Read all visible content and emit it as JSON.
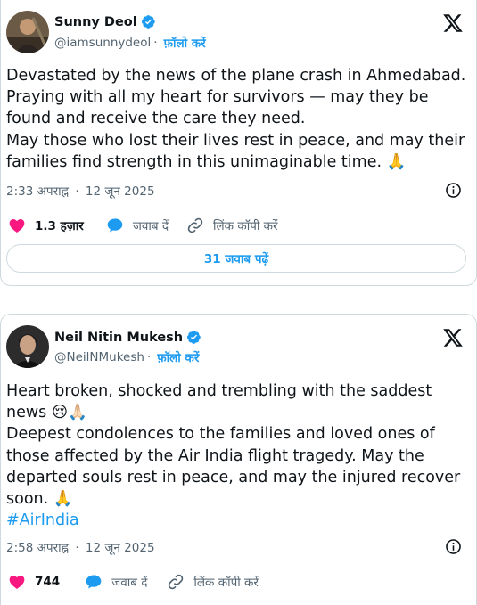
{
  "tweets": [
    {
      "author_name": "Sunny Deol",
      "handle": "@iamsunnydeol",
      "follow_label": "फ़ॉलो करें",
      "body_lines": [
        "Devastated by the news of the plane crash in Ahmedabad.",
        "Praying with all my heart for survivors — may they be",
        "found and receive the care they need.",
        "May those who lost their lives rest in peace, and may their",
        "families find strength in this unimaginable time. 🙏"
      ],
      "time": "2:33 अपराह्न",
      "date": "12 जून 2025",
      "likes": "1.3 हज़ार",
      "reply_label": "जवाब दें",
      "copy_link_label": "लिंक कॉपी करें",
      "read_replies_label": "31 जवाब पढ़ें"
    },
    {
      "author_name": "Neil Nitin Mukesh",
      "handle": "@NeilNMukesh",
      "follow_label": "फ़ॉलो करें",
      "body_lines": [
        "Heart broken, shocked and trembling with the saddest",
        "news 😢🙏🏻",
        "Deepest condolences to the families and loved ones of",
        "those affected by the Air India flight tragedy. May the",
        "departed souls rest in peace, and may the injured recover",
        "soon. 🙏"
      ],
      "hashtag": "#AirIndia",
      "time": "2:58 अपराह्न",
      "date": "12 जून 2025",
      "likes": "744",
      "reply_label": "जवाब दें",
      "copy_link_label": "लिंक कॉपी करें"
    }
  ],
  "colors": {
    "accent": "#1d9bf0",
    "like": "#f91880",
    "secondary_text": "#536471",
    "border": "#cfd9de"
  },
  "icons": [
    "verified-badge-icon",
    "x-logo-icon",
    "info-icon",
    "heart-icon",
    "reply-bubble-icon",
    "link-icon"
  ]
}
